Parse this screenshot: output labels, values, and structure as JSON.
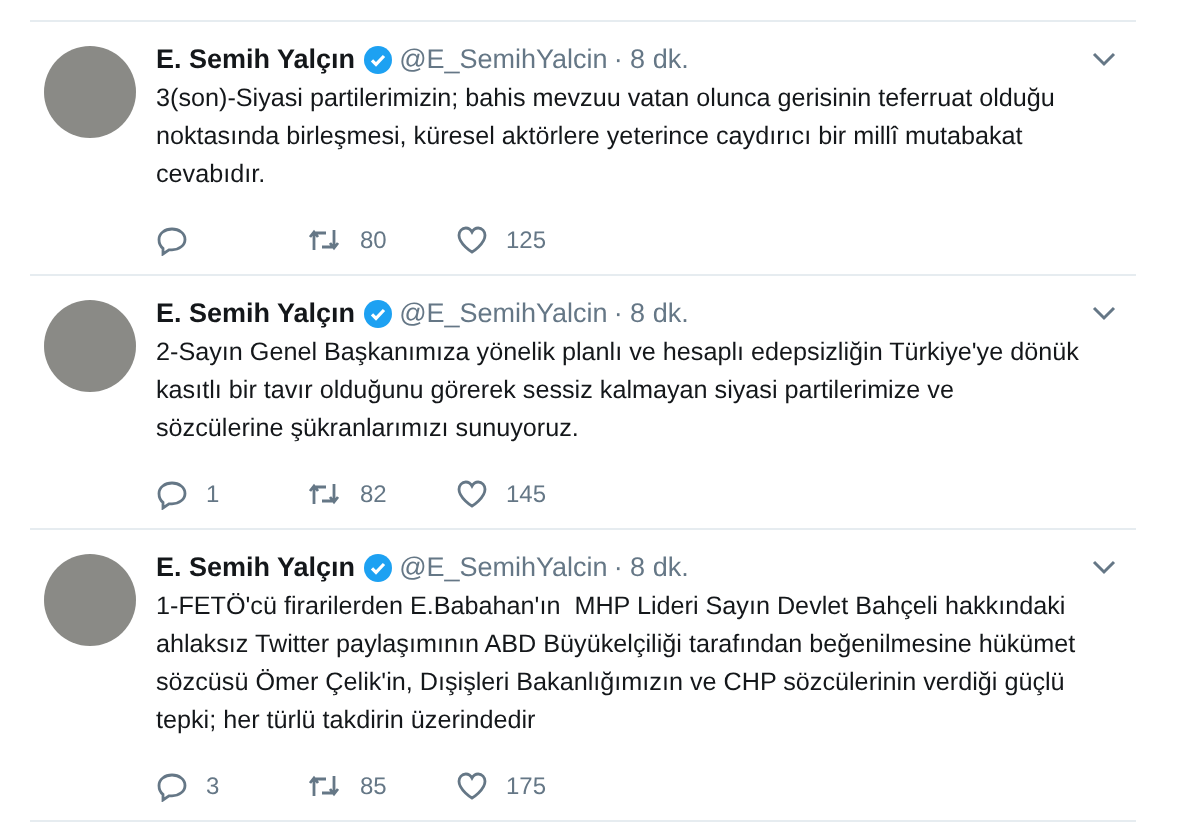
{
  "tweets": [
    {
      "name": "E. Semih Yalçın",
      "verified": true,
      "handle": "@E_SemihYalcin",
      "time": "· 8 dk.",
      "text": "3(son)-Siyasi partilerimizin; bahis mevzuu vatan olunca gerisinin teferruat olduğu noktasında birleşmesi, küresel aktörlere yeterince caydırıcı bir millî mutabakat cevabıdır.",
      "retweets": "80",
      "likes": "125"
    },
    {
      "name": "E. Semih Yalçın",
      "verified": true,
      "handle": "@E_SemihYalcin",
      "time": "· 8 dk.",
      "text": "2-Sayın Genel Başkanımıza yönelik planlı ve hesaplı edepsizliğin Türkiye'ye dönük kasıtlı bir tavır olduğunu görerek sessiz kalmayan siyasi partilerimize ve sözcülerine şükranlarımızı sunuyoruz.",
      "replies": "1",
      "retweets": "82",
      "likes": "145"
    },
    {
      "name": "E. Semih Yalçın",
      "verified": true,
      "handle": "@E_SemihYalcin",
      "time": "· 8 dk.",
      "text": "1-FETÖ'cü firarilerden E.Babahan'ın  MHP Lideri Sayın Devlet Bahçeli hakkındaki ahlaksız Twitter paylaşımının ABD Büyükelçiliği tarafından beğenilmesine hükümet sözcüsü Ömer Çelik'in, Dışişleri Bakanlığımızın ve CHP sözcülerinin verdiği güçlü tepki; her türlü takdirin üzerindedir",
      "replies": "3",
      "retweets": "85",
      "likes": "175"
    }
  ]
}
